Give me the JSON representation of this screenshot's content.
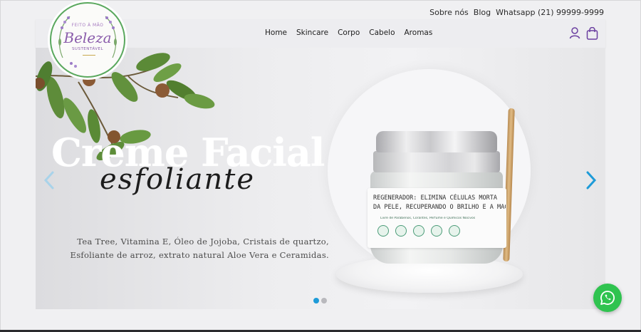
{
  "topbar": {
    "about": "Sobre nós",
    "blog": "Blog",
    "whatsapp": "Whatsapp (21) 99999-9999"
  },
  "logo": {
    "tagline": "FEITO À MÃO",
    "name": "Beleza",
    "subtitle": "SUSTENTÁVEL"
  },
  "nav": {
    "items": [
      {
        "label": "Home"
      },
      {
        "label": "Skincare"
      },
      {
        "label": "Corpo"
      },
      {
        "label": "Cabelo"
      },
      {
        "label": "Aromas"
      }
    ],
    "icons": [
      "user-icon",
      "shopping-bag-icon"
    ]
  },
  "hero": {
    "title": "Creme Facial",
    "script": "esfoliante",
    "description_line1": "Tea Tree, Vitamina E, Óleo de Jojoba, Cristais de quartzo,",
    "description_line2": "Esfoliante de arroz, extrato natural Aloe Vera e Ceramidas.",
    "jar_label_line1": "REGENERADOR: ELIMINA CÉLULAS MORTA",
    "jar_label_line2": "DA PELE, RECUPERANDO O BRILHO E A MACIE",
    "jar_label_small": "Livre de Parabenos, Corantes, Perfume e Químicos Nocivos",
    "slides": {
      "total": 2,
      "active": 1
    }
  },
  "colors": {
    "accent_blue": "#1e9bd8",
    "whatsapp_green": "#2fc34f",
    "logo_purple": "#8a5cab",
    "logo_green": "#5aa85e"
  },
  "floating": {
    "icon": "whatsapp-icon"
  }
}
